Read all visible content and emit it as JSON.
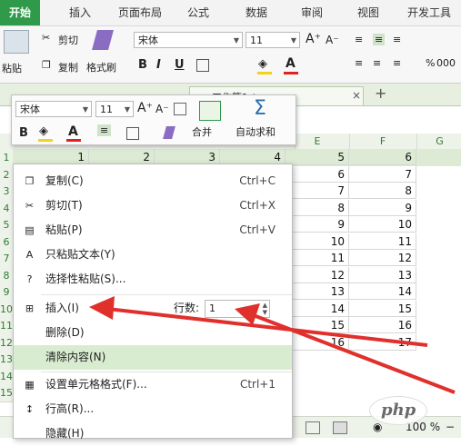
{
  "ribbon_tabs": [
    "开始",
    "插入",
    "页面布局",
    "公式",
    "数据",
    "审阅",
    "视图",
    "开发工具"
  ],
  "clipboard": {
    "paste": "粘贴",
    "cut": "剪切",
    "copy": "复制",
    "format_painter": "格式刷"
  },
  "font": {
    "name": "宋体",
    "size": "11",
    "bold": "B",
    "italic": "I",
    "underline": "U"
  },
  "number_format": {
    "percent": "%",
    "thousands": "000"
  },
  "doc_tab": {
    "name": "工作簿1 *",
    "add": "+",
    "close": "×"
  },
  "mini_toolbar": {
    "font_name": "宋体",
    "font_size": "11",
    "bold": "B",
    "merge_label": "合并",
    "autosum_label": "自动求和",
    "sigma": "Σ"
  },
  "columns": [
    "E",
    "F",
    "G"
  ],
  "rows": [
    "1",
    "2",
    "3",
    "4",
    "5",
    "6",
    "7",
    "8",
    "9",
    "10",
    "11",
    "12",
    "13",
    "14",
    "15"
  ],
  "row1_values": [
    "1",
    "2",
    "3",
    "4",
    "5",
    "6"
  ],
  "col_e_values": [
    "6",
    "7",
    "8",
    "9",
    "10",
    "11",
    "12",
    "13",
    "14",
    "15",
    "16"
  ],
  "col_f_values": [
    "7",
    "8",
    "9",
    "10",
    "11",
    "12",
    "13",
    "14",
    "15",
    "16",
    "17"
  ],
  "context_menu": {
    "copy": {
      "label": "复制(C)",
      "shortcut": "Ctrl+C"
    },
    "cut": {
      "label": "剪切(T)",
      "shortcut": "Ctrl+X"
    },
    "paste": {
      "label": "粘贴(P)",
      "shortcut": "Ctrl+V"
    },
    "paste_text": {
      "label": "只粘贴文本(Y)"
    },
    "paste_special": {
      "label": "选择性粘贴(S)..."
    },
    "insert": {
      "label": "插入(I)",
      "rows_label": "行数:",
      "rows_value": "1"
    },
    "delete": {
      "label": "删除(D)"
    },
    "clear": {
      "label": "清除内容(N)"
    },
    "format_cells": {
      "label": "设置单元格格式(F)...",
      "shortcut": "Ctrl+1"
    },
    "row_height": {
      "label": "行高(R)..."
    },
    "hide": {
      "label": "隐藏(H)"
    }
  },
  "status_bar": {
    "zoom": "100 %"
  },
  "watermark": "php",
  "colors": {
    "accent_green": "#2e9a4a",
    "highlight": "#d8ecd0",
    "arrow_red": "#e0302c"
  }
}
